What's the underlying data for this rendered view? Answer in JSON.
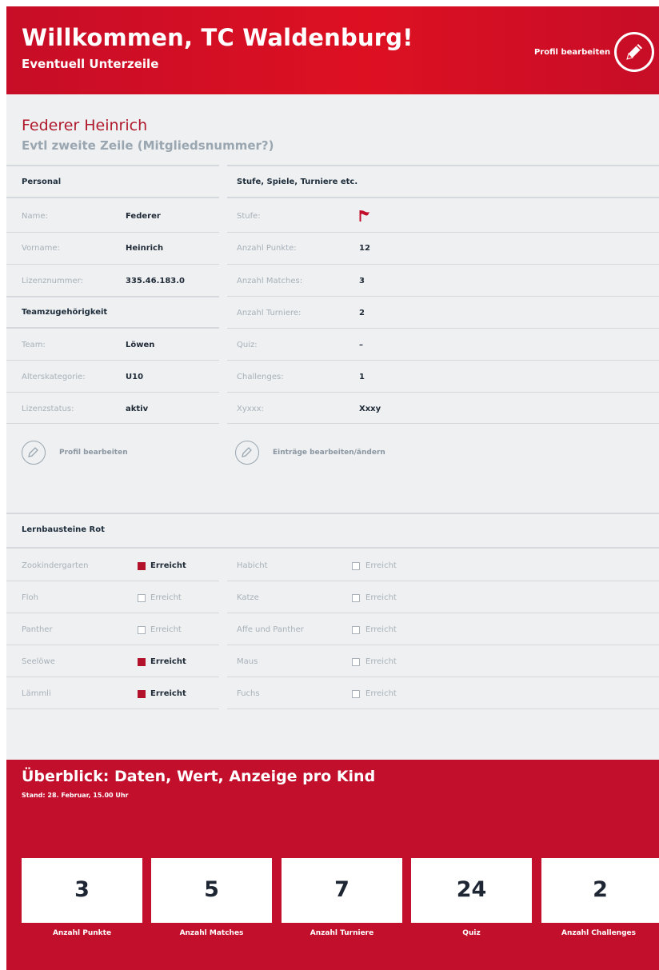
{
  "header": {
    "title": "Willkommen, TC Waldenburg!",
    "subtitle": "Eventuell Unterzeile",
    "edit_label": "Profil bearbeiten",
    "edit_icon": "pencil-icon"
  },
  "person": {
    "name": "Federer Heinrich",
    "second_line": "Evtl zweite Zeile (Mitgliedsnummer?)"
  },
  "personal": {
    "heading": "Personal",
    "rows": [
      {
        "label": "Name:",
        "value": "Federer"
      },
      {
        "label": "Vorname:",
        "value": "Heinrich"
      },
      {
        "label": "Lizenznummer:",
        "value": "335.46.183.0"
      }
    ]
  },
  "team": {
    "heading": "Teamzugehörigkeit",
    "rows": [
      {
        "label": "Team:",
        "value": "Löwen"
      },
      {
        "label": "Alterskategorie:",
        "value": "U10"
      },
      {
        "label": "Lizenzstatus:",
        "value": "aktiv"
      }
    ],
    "edit_label": "Profil bearbeiten"
  },
  "stats": {
    "heading": "Stufe, Spiele, Turniere etc.",
    "stufe_label": "Stufe:",
    "stufe_icon": "red-flag-icon",
    "rows": [
      {
        "label": "Anzahl Punkte:",
        "value": "12"
      },
      {
        "label": "Anzahl Matches:",
        "value": "3"
      },
      {
        "label": "Anzahl Turniere:",
        "value": "2"
      },
      {
        "label": "Quiz:",
        "value": "–"
      },
      {
        "label": "Challenges:",
        "value": "1"
      },
      {
        "label": "Xyxxx:",
        "value": "Xxxy"
      }
    ],
    "edit_label": "Einträge bearbeiten/ändern"
  },
  "lernbausteine": {
    "heading": "Lernbausteine Rot",
    "status_text": "Erreicht",
    "left": [
      {
        "label": "Zookindergarten",
        "reached": true
      },
      {
        "label": "Floh",
        "reached": false
      },
      {
        "label": "Panther",
        "reached": false
      },
      {
        "label": "Seelöwe",
        "reached": true
      },
      {
        "label": "Lämmli",
        "reached": true
      }
    ],
    "right": [
      {
        "label": "Habicht",
        "reached": false
      },
      {
        "label": "Katze",
        "reached": false
      },
      {
        "label": "Affe und Panther",
        "reached": false
      },
      {
        "label": "Maus",
        "reached": false
      },
      {
        "label": "Fuchs",
        "reached": false
      }
    ]
  },
  "overview": {
    "title": "Überblick: Daten, Wert, Anzeige pro Kind",
    "stand": "Stand: 28. Februar, 15.00 Uhr",
    "cards": [
      {
        "value": "3",
        "label": "Anzahl Punkte"
      },
      {
        "value": "5",
        "label": "Anzahl Matches"
      },
      {
        "value": "7",
        "label": "Anzahl Turniere"
      },
      {
        "value": "24",
        "label": "Quiz"
      },
      {
        "value": "2",
        "label": "Anzahl Challenges"
      }
    ]
  },
  "colors": {
    "brand_red": "#c20f2c",
    "checked_red": "#b3122a",
    "name_red": "#b01a2c"
  }
}
